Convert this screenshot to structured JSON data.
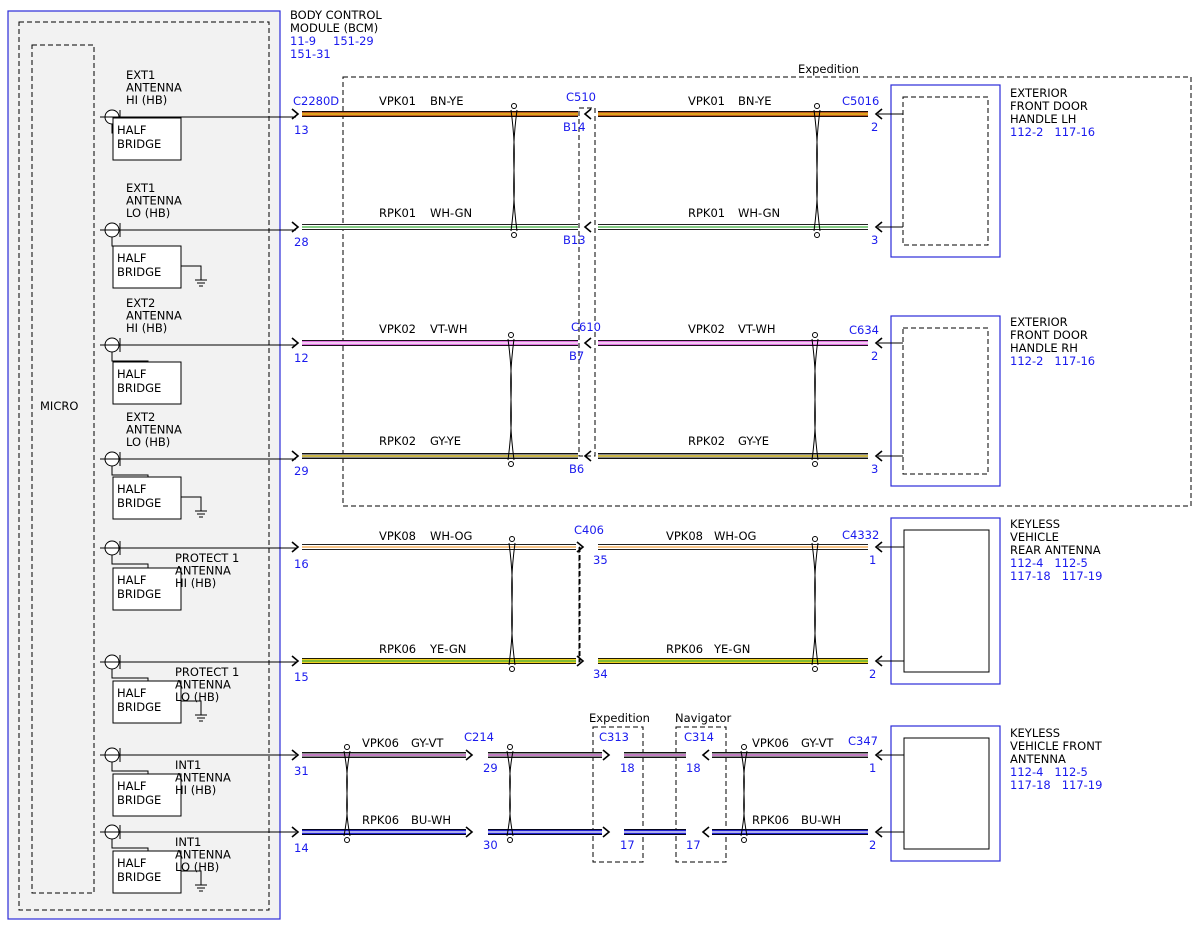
{
  "bcm": {
    "title_lines": [
      "BODY CONTROL",
      "MODULE (BCM)"
    ],
    "refs_line1": [
      "11-9",
      "151-29"
    ],
    "refs_line2": [
      "151-31"
    ],
    "micro_label": "MICRO",
    "half_bridge_lines": [
      "HALF",
      "BRIDGE"
    ]
  },
  "antenna_labels": [
    [
      "EXT1",
      "ANTENNA",
      "HI (HB)"
    ],
    [
      "EXT1",
      "ANTENNA",
      "LO (HB)"
    ],
    [
      "EXT2",
      "ANTENNA",
      "HI (HB)"
    ],
    [
      "EXT2",
      "ANTENNA",
      "LO (HB)"
    ],
    [
      "PROTECT 1",
      "ANTENNA",
      "HI (HB)"
    ],
    [
      "PROTECT 1",
      "ANTENNA",
      "LO (HB)"
    ],
    [
      "INT1",
      "ANTENNA",
      "HI (HB)"
    ],
    [
      "INT1",
      "ANTENNA",
      "LO (HB)"
    ]
  ],
  "bcm_connector": "C2280D",
  "bcm_pins": [
    "13",
    "28",
    "12",
    "29",
    "16",
    "15",
    "31",
    "14"
  ],
  "region_labels": {
    "expedition_top": "Expedition",
    "expedition_inline": "Expedition",
    "navigator_inline": "Navigator"
  },
  "connectors": {
    "c510": "C510",
    "c5016": "C5016",
    "c610": "C610",
    "c634": "C634",
    "c406": "C406",
    "c4332": "C4332",
    "c214": "C214",
    "c313": "C313",
    "c314": "C314",
    "c347": "C347"
  },
  "pins": {
    "b14": "B14",
    "b13": "B13",
    "b7": "B7",
    "b6": "B6",
    "p35": "35",
    "p34": "34",
    "p29": "29",
    "p30": "30",
    "p18a": "18",
    "p17a": "17",
    "p18b": "18",
    "p17b": "17",
    "lh_hi": "2",
    "lh_lo": "3",
    "rh_hi": "2",
    "rh_lo": "3",
    "rear_hi": "1",
    "rear_lo": "2",
    "front_hi": "1",
    "front_lo": "2"
  },
  "wires": {
    "vpk01": {
      "circuit": "VPK01",
      "color": "BN-YE"
    },
    "rpk01": {
      "circuit": "RPK01",
      "color": "WH-GN"
    },
    "vpk02": {
      "circuit": "VPK02",
      "color": "VT-WH"
    },
    "rpk02": {
      "circuit": "RPK02",
      "color": "GY-YE"
    },
    "vpk08": {
      "circuit": "VPK08",
      "color": "WH-OG"
    },
    "rpk06a": {
      "circuit": "RPK06",
      "color": "YE-GN"
    },
    "vpk06": {
      "circuit": "VPK06",
      "color": "GY-VT"
    },
    "rpk06b": {
      "circuit": "RPK06",
      "color": "BU-WH"
    }
  },
  "wire_colors": {
    "brown": "#c05a1e",
    "yellow": "#f0d020",
    "white": "#ffffff",
    "green": "#3fae3f",
    "violet": "#e070e0",
    "gray": "#8a8a8a",
    "orange": "#f0a040",
    "blue": "#2020d0",
    "accent_blue": "#1a1aee"
  },
  "devices": {
    "lh": {
      "lines": [
        "EXTERIOR",
        "FRONT DOOR",
        "HANDLE LH"
      ],
      "refs": "112-2   117-16"
    },
    "rh": {
      "lines": [
        "EXTERIOR",
        "FRONT DOOR",
        "HANDLE RH"
      ],
      "refs": "112-2   117-16"
    },
    "rear": {
      "lines": [
        "KEYLESS",
        "VEHICLE",
        "REAR ANTENNA"
      ],
      "refs1": "112-4   112-5",
      "refs2": "117-18   117-19"
    },
    "front": {
      "lines": [
        "KEYLESS",
        "VEHICLE FRONT",
        "ANTENNA"
      ],
      "refs1": "112-4   112-5",
      "refs2": "117-18   117-19"
    }
  }
}
